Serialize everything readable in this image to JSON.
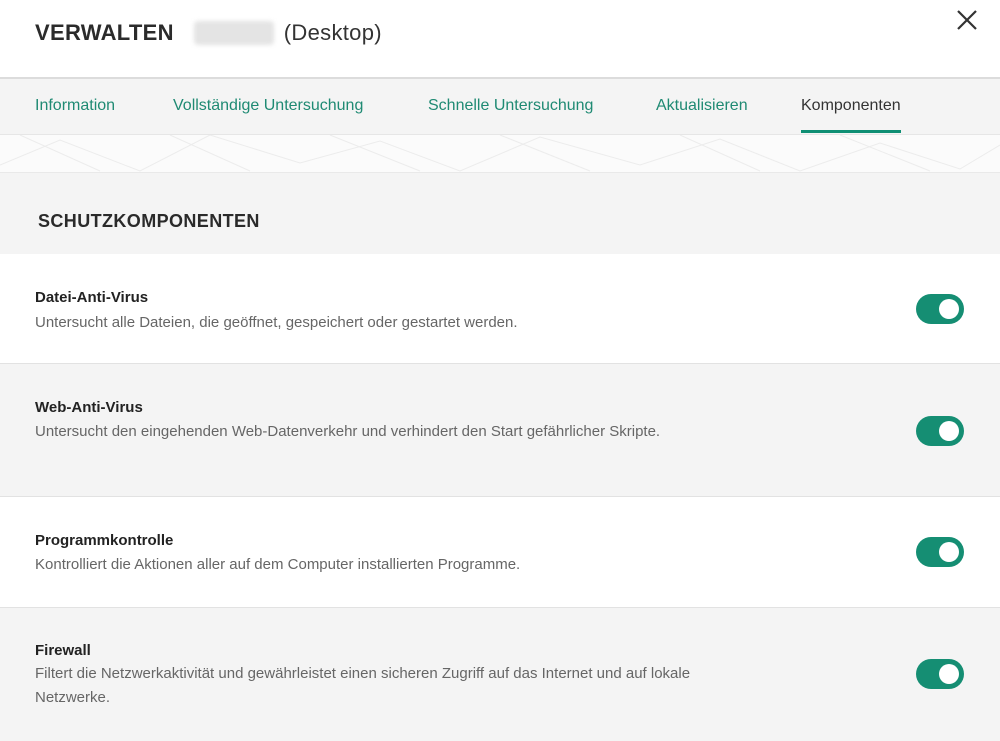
{
  "header": {
    "title": "VERWALTEN",
    "device_suffix": "(Desktop)"
  },
  "tabs": [
    {
      "label": "Information",
      "active": false
    },
    {
      "label": "Vollständige Untersuchung",
      "active": false
    },
    {
      "label": "Schnelle Untersuchung",
      "active": false
    },
    {
      "label": "Aktualisieren",
      "active": false
    },
    {
      "label": "Komponenten",
      "active": true
    }
  ],
  "section": {
    "title": "SCHUTZKOMPONENTEN"
  },
  "components": [
    {
      "name": "Datei-Anti-Virus",
      "description": "Untersucht alle Dateien, die geöffnet, gespeichert oder gestartet werden.",
      "enabled": true
    },
    {
      "name": "Web-Anti-Virus",
      "description": "Untersucht den eingehenden Web-Datenverkehr und verhindert den Start gefährlicher Skripte.",
      "enabled": true
    },
    {
      "name": "Programmkontrolle",
      "description": "Kontrolliert die Aktionen aller auf dem Computer installierten Programme.",
      "enabled": true
    },
    {
      "name": "Firewall",
      "description": "Filtert die Netzwerkaktivität und gewährleistet einen sicheren Zugriff auf das Internet und auf lokale Netzwerke.",
      "enabled": true
    }
  ],
  "colors": {
    "accent": "#158e73",
    "tab_text": "#1f8a73"
  },
  "icons": {
    "close": "close-icon"
  }
}
